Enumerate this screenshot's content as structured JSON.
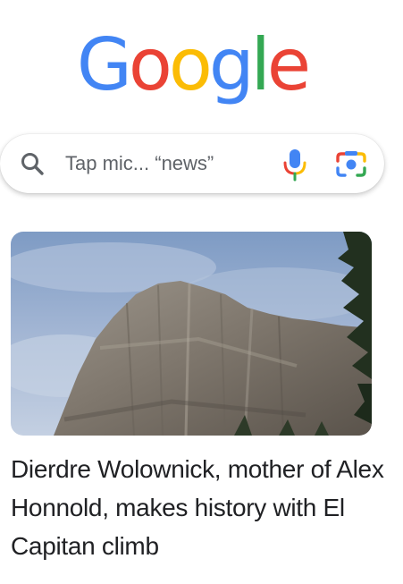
{
  "logo": {
    "text": "Google",
    "letters": [
      "G",
      "o",
      "o",
      "g",
      "l",
      "e"
    ],
    "colors": [
      "#4285F4",
      "#EA4335",
      "#FBBC05",
      "#4285F4",
      "#34A853",
      "#EA4335"
    ]
  },
  "search": {
    "placeholder": "Tap mic... “news”",
    "search_icon": "search-icon",
    "mic_icon": "microphone-icon",
    "lens_icon": "google-lens-icon"
  },
  "feed": {
    "card": {
      "image": "El Capitan rock face under cloudy sky",
      "headline": "Dierdre Wolownick, mother of Alex Honnold, makes history with El Capitan climb"
    }
  }
}
